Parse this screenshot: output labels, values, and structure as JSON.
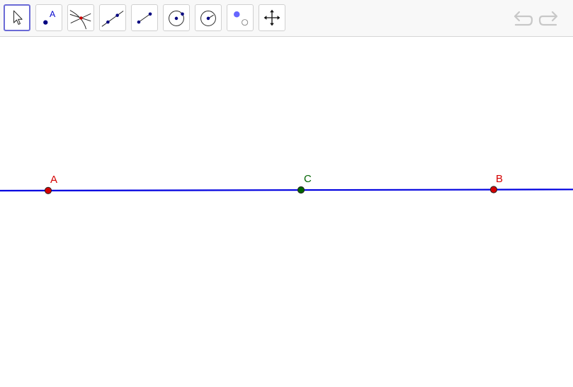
{
  "toolbar": {
    "tools": [
      {
        "name": "move-tool",
        "icon": "arrow-pointer-icon",
        "active": true
      },
      {
        "name": "point-tool",
        "icon": "point-icon",
        "icon_label": "A"
      },
      {
        "name": "intersect-tool",
        "icon": "intersect-icon"
      },
      {
        "name": "line-tool",
        "icon": "line-through-two-points-icon"
      },
      {
        "name": "segment-tool",
        "icon": "segment-icon"
      },
      {
        "name": "circle-center-point-tool",
        "icon": "circle-center-point-icon"
      },
      {
        "name": "circle-center-radius-tool",
        "icon": "circle-center-radius-icon"
      },
      {
        "name": "show-hide-object-tool",
        "icon": "show-hide-icon"
      },
      {
        "name": "move-graphics-view-tool",
        "icon": "move-view-icon"
      }
    ],
    "undo_icon": "undo-icon",
    "redo_icon": "redo-icon"
  },
  "colors": {
    "line": "#0000e0",
    "free_point": "#d40000",
    "dependent_point": "#006400",
    "active_tool_border": "#6b6bd6",
    "tool_icon_point": "#000080"
  },
  "points": [
    {
      "id": "A",
      "label": "A",
      "kind": "free"
    },
    {
      "id": "C",
      "label": "C",
      "kind": "dependent"
    },
    {
      "id": "B",
      "label": "B",
      "kind": "free"
    }
  ]
}
